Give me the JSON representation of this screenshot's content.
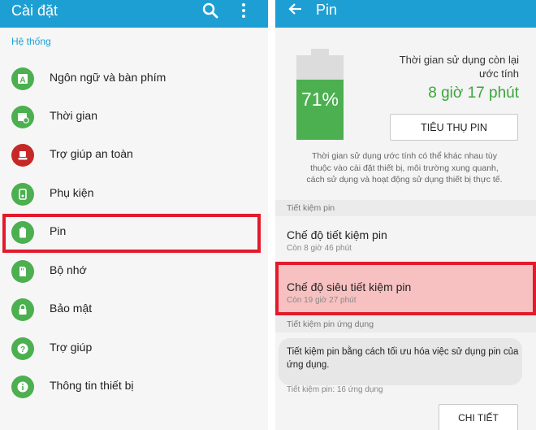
{
  "settings": {
    "title": "Cài đặt",
    "section": "Hệ thống",
    "items": [
      {
        "label": "Ngôn ngữ và bàn phím",
        "icon": "keyboard-icon"
      },
      {
        "label": "Thời gian",
        "icon": "calendar-clock-icon"
      },
      {
        "label": "Trợ giúp an toàn",
        "icon": "safety-icon"
      },
      {
        "label": "Phụ kiện",
        "icon": "accessory-icon"
      },
      {
        "label": "Pin",
        "icon": "battery-icon"
      },
      {
        "label": "Bộ nhớ",
        "icon": "storage-icon"
      },
      {
        "label": "Bảo mật",
        "icon": "lock-icon"
      },
      {
        "label": "Trợ giúp",
        "icon": "help-icon"
      },
      {
        "label": "Thông tin thiết bị",
        "icon": "device-info-icon"
      }
    ]
  },
  "battery": {
    "title": "Pin",
    "level_percent": "71%",
    "level_fraction": 0.71,
    "usage_label_line1": "Thời gian sử dụng còn lại",
    "usage_label_line2": "ước tính",
    "remaining_time": "8 giờ 17 phút",
    "usage_button": "TIÊU THỤ PIN",
    "note_line1": "Thời gian sử dụng ước tính có thể khác nhau tùy",
    "note_line2": "thuộc vào cài đặt thiết bị, môi trường xung quanh,",
    "note_line3": "cách sử dụng và hoạt động sử dụng thiết bị thực tế.",
    "saving_section": "Tiết kiệm pin",
    "power_saving": {
      "title": "Chế độ tiết kiệm pin",
      "subtitle": "Còn 8 giờ 46 phút"
    },
    "ultra_saving": {
      "title": "Chế độ siêu tiết kiệm pin",
      "subtitle": "Còn 19 giờ 27 phút"
    },
    "app_saving_section": "Tiết kiệm pin ứng dụng",
    "app_saving_line1": "Tiết kiệm pin bằng cách tối ưu hóa việc sử dụng pin của",
    "app_saving_line2": "ứng dụng.",
    "app_saving_count": "Tiết kiệm pin: 16 ứng dụng",
    "details_button": "CHI TIẾT"
  },
  "colors": {
    "appbar": "#1e9fd3",
    "appbar_dark": "#1a8fc0",
    "accent_green": "#4caf50",
    "remaining_green": "#3aa53a",
    "highlight_red": "#e21a2c",
    "highlight_fill": "#f8c1c1"
  }
}
